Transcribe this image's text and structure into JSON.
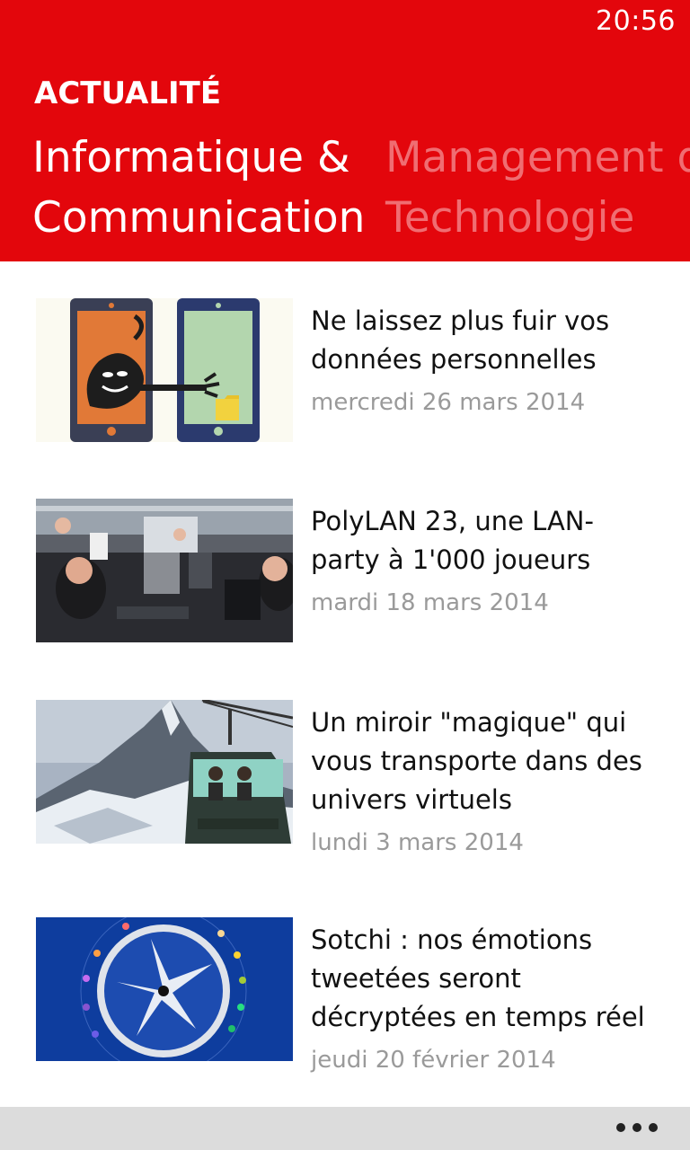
{
  "status": {
    "time": "20:56"
  },
  "header": {
    "app_title": "ACTUALITÉ",
    "pivots": [
      {
        "line1": "Informatique &",
        "line2": "Communication"
      },
      {
        "line1": "Management d",
        "line2": "Technologie"
      }
    ]
  },
  "articles": [
    {
      "title_line1": "Ne laissez plus fuir vos",
      "title_line2": "données personnelles",
      "title_line3": "",
      "date": "mercredi 26 mars 2014",
      "thumbnail": "phones-data-thief-illustration"
    },
    {
      "title_line1": "PolyLAN 23, une LAN-",
      "title_line2": "party à 1'000 joueurs",
      "title_line3": "",
      "date": "mardi 18 mars 2014",
      "thumbnail": "lan-party-gamers-photo"
    },
    {
      "title_line1": "Un miroir \"magique\" qui",
      "title_line2": "vous transporte dans des",
      "title_line3": "univers virtuels",
      "date": "lundi 3 mars 2014",
      "thumbnail": "matterhorn-cable-car-photo"
    },
    {
      "title_line1": "Sotchi : nos émotions",
      "title_line2": "tweetées seront",
      "title_line3": "décryptées en temps réel",
      "date": "jeudi 20 février 2014",
      "thumbnail": "emotion-compass-graphic"
    }
  ],
  "colors": {
    "accent": "#e3060c",
    "inactive_pivot": "#f06d72",
    "date_text": "#9a9a9a",
    "app_bar": "#dcdcdc"
  },
  "app_bar": {
    "more_icon": "ellipsis-icon"
  }
}
